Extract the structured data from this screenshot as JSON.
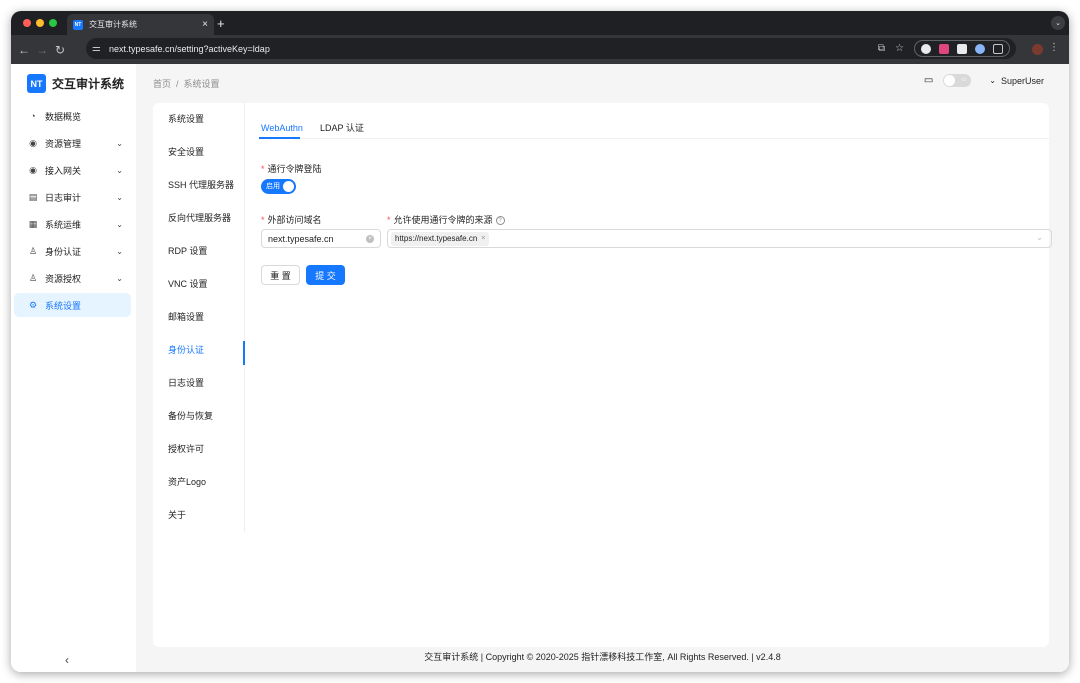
{
  "browser": {
    "tab_title": "交互审计系统",
    "tab_favicon": "NT",
    "url": "next.typesafe.cn/setting?activeKey=ldap"
  },
  "app": {
    "logo_badge": "NT",
    "logo_text": "交互审计系统"
  },
  "sidebar": {
    "items": [
      {
        "label": "数据概览",
        "icon": "dashboard-icon",
        "glyph": "◔",
        "chevron": ""
      },
      {
        "label": "资源管理",
        "icon": "cloud-icon",
        "glyph": "◉",
        "chevron": "⌄"
      },
      {
        "label": "接入网关",
        "icon": "gateway-icon",
        "glyph": "◉",
        "chevron": "⌄"
      },
      {
        "label": "日志审计",
        "icon": "file-audit-icon",
        "glyph": "▤",
        "chevron": "⌄"
      },
      {
        "label": "系统运维",
        "icon": "ops-icon",
        "glyph": "▦",
        "chevron": "⌄"
      },
      {
        "label": "身份认证",
        "icon": "user-icon",
        "glyph": "♙",
        "chevron": "⌄"
      },
      {
        "label": "资源授权",
        "icon": "user-auth-icon",
        "glyph": "♙",
        "chevron": "⌄"
      },
      {
        "label": "系统设置",
        "icon": "settings-icon",
        "glyph": "⚙",
        "chevron": ""
      }
    ],
    "collapse_glyph": "‹"
  },
  "header": {
    "breadcrumb": [
      "首页",
      "系统设置"
    ],
    "breadcrumb_sep": "/",
    "user": "SuperUser"
  },
  "settings_nav": [
    "系统设置",
    "安全设置",
    "SSH 代理服务器",
    "反向代理服务器",
    "RDP 设置",
    "VNC 设置",
    "邮箱设置",
    "身份认证",
    "日志设置",
    "备份与恢复",
    "授权许可",
    "资产Logo",
    "关于"
  ],
  "tabs": [
    "WebAuthn",
    "LDAP 认证"
  ],
  "form": {
    "passkey_label": "通行令牌登陆",
    "switch_text": "启用",
    "domain_label": "外部访问域名",
    "domain_value": "next.typesafe.cn",
    "origins_label": "允许使用通行令牌的来源",
    "origin_tag": "https://next.typesafe.cn",
    "reset_label": "重 置",
    "submit_label": "提 交"
  },
  "footer": "交互审计系统 | Copyright © 2020-2025 指针漂移科技工作室, All Rights Reserved. | v2.4.8",
  "colors": {
    "primary": "#1677ff",
    "required": "#ff4d4f",
    "sidebar_active_bg": "#e6f4ff",
    "content_bg": "#f5f5f5"
  }
}
